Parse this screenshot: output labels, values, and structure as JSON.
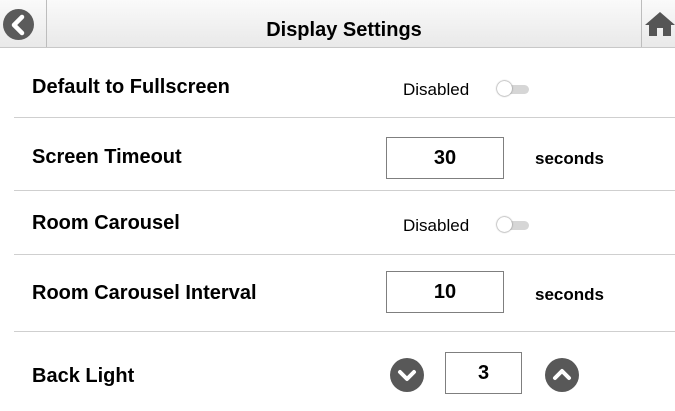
{
  "header": {
    "title": "Display Settings",
    "back_icon": "chevron-left-circle-icon",
    "home_icon": "home-icon"
  },
  "settings": {
    "fullscreen": {
      "label": "Default to Fullscreen",
      "state": "Disabled",
      "enabled": false
    },
    "timeout": {
      "label": "Screen Timeout",
      "value": "30",
      "unit": "seconds"
    },
    "carousel": {
      "label": "Room Carousel",
      "state": "Disabled",
      "enabled": false
    },
    "carousel_interval": {
      "label": "Room Carousel Interval",
      "value": "10",
      "unit": "seconds"
    },
    "back_light": {
      "label": "Back Light",
      "value": "3",
      "decrease_icon": "chevron-down-circle-icon",
      "increase_icon": "chevron-up-circle-icon"
    }
  },
  "colors": {
    "icon_dark": "#585858",
    "border": "#7f7f7f"
  }
}
